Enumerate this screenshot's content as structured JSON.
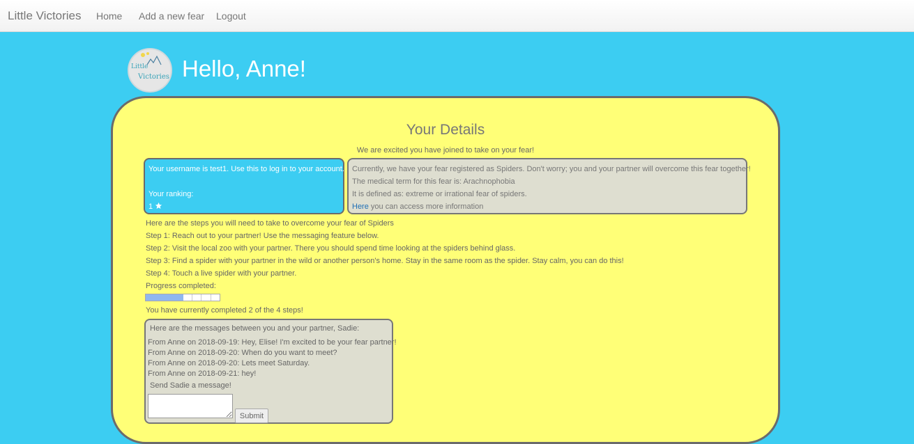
{
  "nav": {
    "brand": "Little Victories",
    "links": [
      "Home",
      "Add a new fear",
      "Logout"
    ]
  },
  "logo": {
    "line1": "Little",
    "line2": "Victories"
  },
  "greeting": "Hello, Anne!",
  "details": {
    "title": "Your Details",
    "subtitle": "We are excited you have joined to take on your fear!",
    "account": {
      "username_line": "Your username is test1. Use this to log in to your account.",
      "ranking_label": "Your ranking:",
      "ranking_value": "1",
      "ranking_icon": "star-icon"
    },
    "fear": {
      "line1": "Currently, we have your fear registered as Spiders. Don't worry; you and your partner will overcome this fear together!",
      "line2": "The medical term for this fear is: Arachnophobia",
      "line3": "It is defined as: extreme or irrational fear of spiders.",
      "link_text": "Here",
      "link_suffix": "you can access more information"
    }
  },
  "steps": {
    "intro": "Here are the steps you will need to take to overcome your fear of Spiders",
    "items": [
      "Step 1: Reach out to your partner! Use the messaging feature below.",
      "Step 2: Visit the local zoo with your partner. There you should spend time looking at the spiders behind glass.",
      "Step 3: Find a spider with your partner in the wild or another person's home. Stay in the same room as the spider. Stay calm, you can do this!",
      "Step 4: Touch a live spider with your partner."
    ],
    "progress_label": "Progress completed:",
    "progress_completed": 2,
    "progress_total": 4,
    "completed_text": "You have currently completed 2 of the 4 steps!"
  },
  "messages": {
    "header": "Here are the messages between you and your partner, Sadie:",
    "items": [
      "From Anne on 2018-09-19: Hey, Elise! I'm excited to be your fear partner!",
      "From Anne on 2018-09-20: When do you want to meet?",
      "From Anne on 2018-09-20: Lets meet Saturday.",
      "From Anne on 2018-09-21: hey!"
    ],
    "send_label": "Send Sadie a message!",
    "input_value": "",
    "submit_label": "Submit"
  },
  "colors": {
    "page_bg": "#3ccdf2",
    "card_bg": "#ffff77",
    "info_bg": "#deded0",
    "progress_fill": "#8fb7f0"
  }
}
